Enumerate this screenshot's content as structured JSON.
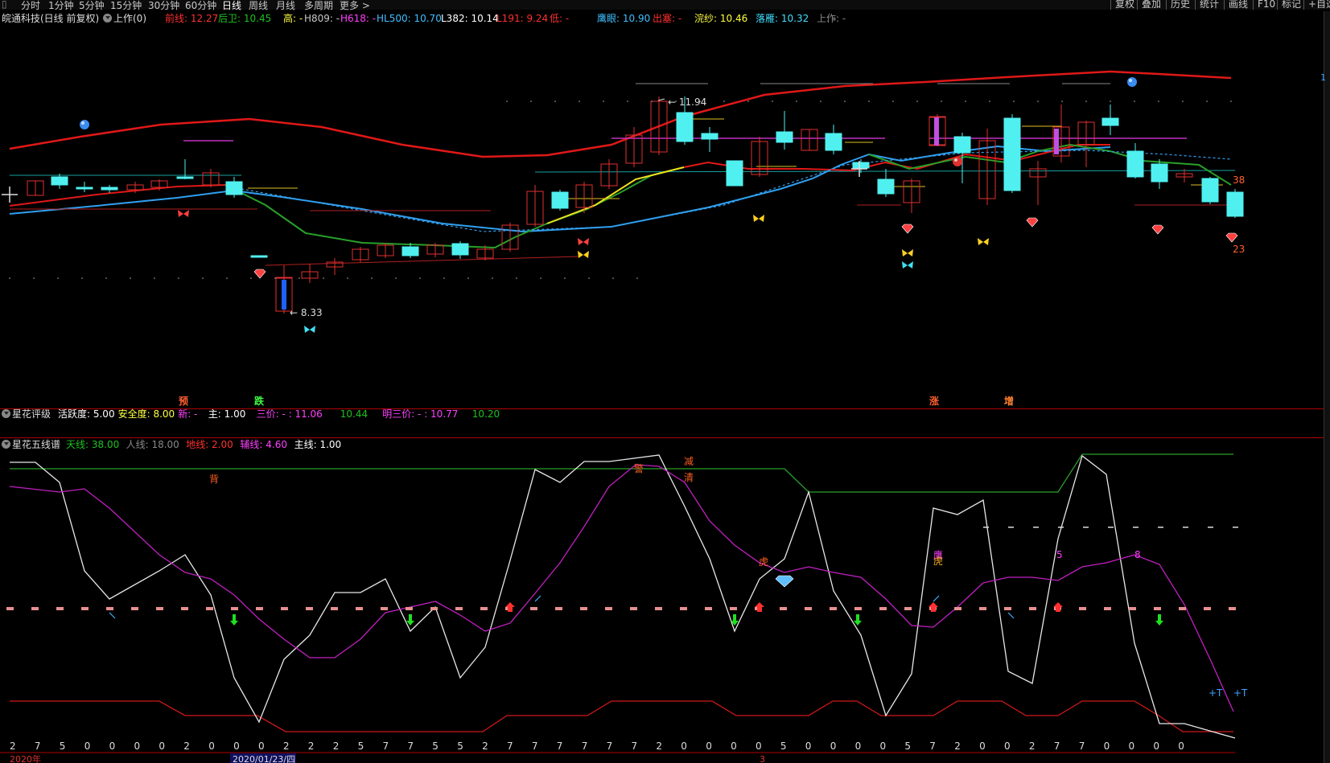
{
  "menu": {
    "fenshi_tab": "分时",
    "m1_tab": "1分钟",
    "m5_tab": "5分钟",
    "m15_tab": "15分钟",
    "m30_tab": "30分钟",
    "m60_tab": "60分钟",
    "day_tab": "日线",
    "week_tab": "周线",
    "month_tab": "月线",
    "multi_tab": "多周期",
    "more_tab": "更多 >",
    "btn_fuquan": "复权",
    "btn_diejia": "叠加",
    "btn_lishi": "历史",
    "btn_tongji": "统计",
    "btn_huaxian": "画线",
    "btn_f10": "F10",
    "btn_biaoji": "标记",
    "btn_zixuan": "+自选"
  },
  "main_header": {
    "stock": "皖通科技(日线 前复权)",
    "indicator": "上作(0)",
    "items": [
      {
        "label": "前线:",
        "value": "12.27",
        "color": "#ff3030"
      },
      {
        "label": "后卫:",
        "value": "10.45",
        "color": "#20c020"
      },
      {
        "label": "高:",
        "value": "-",
        "color": "#ffff40"
      },
      {
        "label": "H809:",
        "value": "-",
        "color": "#c8c8c8"
      },
      {
        "label": "H618:",
        "value": "-",
        "color": "#ff40ff"
      },
      {
        "label": "HL500:",
        "value": "10.70",
        "color": "#40c0ff"
      },
      {
        "label": "L382:",
        "value": "10.14",
        "color": "#ffffff"
      },
      {
        "label": "L191:",
        "value": "9.24",
        "color": "#ff3030"
      },
      {
        "label": "低:",
        "value": "-",
        "color": "#ff3030"
      },
      {
        "label": "鹰眼:",
        "value": "10.90",
        "color": "#40c0ff"
      },
      {
        "label": "出塞:",
        "value": "-",
        "color": "#ff3030"
      },
      {
        "label": "浣纱:",
        "value": "10.46",
        "color": "#ffff40"
      },
      {
        "label": "落雁:",
        "value": "10.32",
        "color": "#40e0ff"
      },
      {
        "label": "上:",
        "value": "-",
        "color": "#888888"
      },
      {
        "label": "作:",
        "value": "-",
        "color": "#888888"
      }
    ]
  },
  "main_chart": {
    "high_label": "11.94",
    "low_label": "8.33",
    "right_val_top": "38",
    "right_val_bot": "23",
    "axis_tag": "1",
    "signals": [
      "预",
      "跌",
      "涨",
      "增"
    ]
  },
  "panel2": {
    "title": "星花评级",
    "items": [
      {
        "label": "活跃度:",
        "value": "5.00",
        "color": "#ffffff"
      },
      {
        "label": "安全度:",
        "value": "8.00",
        "color": "#ffff40"
      },
      {
        "label": "新:",
        "value": "-",
        "color": "#ff40ff"
      },
      {
        "label": "主:",
        "value": "1.00",
        "color": "#ffffff"
      },
      {
        "label": "三价:",
        "value": "- : 11.06",
        "color": "#ff40ff"
      },
      {
        "label": "",
        "value": "10.44",
        "color": "#20c020"
      },
      {
        "label": "明三价:",
        "value": "- : 10.77",
        "color": "#ff40ff"
      },
      {
        "label": "",
        "value": "10.20",
        "color": "#20c020"
      }
    ]
  },
  "panel3": {
    "title": "星花五线谱",
    "items": [
      {
        "label": "天线:",
        "value": "38.00",
        "color": "#20c020"
      },
      {
        "label": "人线:",
        "value": "18.00",
        "color": "#888888"
      },
      {
        "label": "地线:",
        "value": "2.00",
        "color": "#ff3030"
      },
      {
        "label": "辅线:",
        "value": "4.60",
        "color": "#ff40ff"
      },
      {
        "label": "主线:",
        "value": "1.00",
        "color": "#ffffff"
      }
    ],
    "annotations": {
      "bei": "背",
      "jing1": "警",
      "jian": "减",
      "qing": "清",
      "hu1": "虎",
      "ying": "鹰",
      "hu2": "虎",
      "five": "5",
      "eight": "8",
      "plus_t": "+T"
    }
  },
  "bottom_axis": {
    "digits": [
      "2",
      "7",
      "5",
      "0",
      "0",
      "0",
      "0",
      "2",
      "0",
      "0",
      "0",
      "2",
      "2",
      "2",
      "5",
      "7",
      "7",
      "5",
      "5",
      "2",
      "7",
      "7",
      "7",
      "7",
      "7",
      "7",
      "2",
      "0",
      "0",
      "0",
      "0",
      "5",
      "0",
      "0",
      "0",
      "0",
      "5",
      "7",
      "2",
      "0",
      "0",
      "2",
      "7",
      "7",
      "0",
      "0",
      "0",
      "0"
    ],
    "date_year": "2020年",
    "date_cursor": "2020/01/23/四",
    "date_mid": "3"
  }
}
